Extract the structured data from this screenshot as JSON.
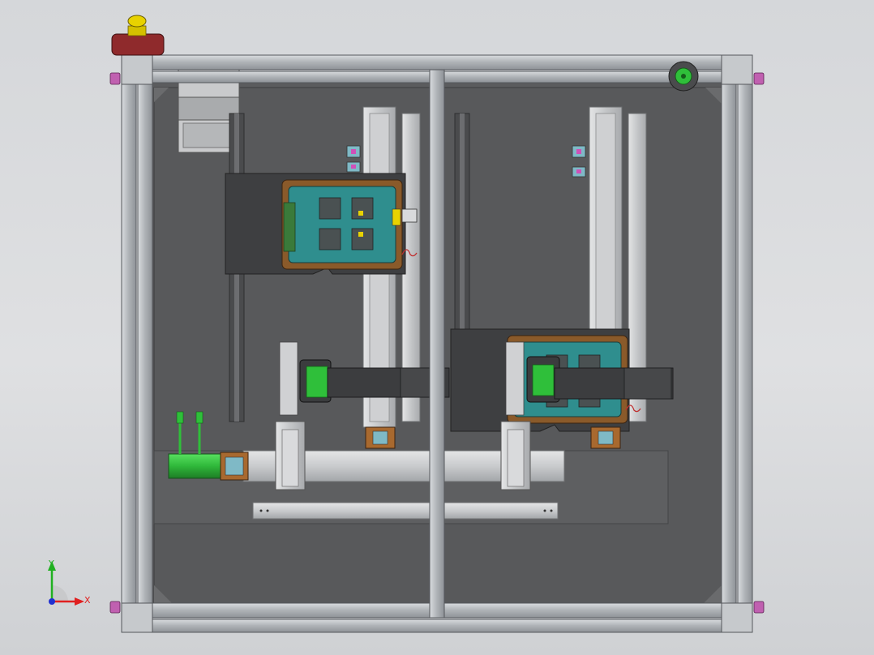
{
  "viewport": {
    "background_top": "#d5d7da",
    "background_bottom": "#cfd1d4"
  },
  "colors": {
    "frame_aluminium": "#b4b8bd",
    "base_plate": "#5a5b5d",
    "rail_silver": "#c7c8c9",
    "fixture_teal": "#2f8e8e",
    "fixture_copper": "#8a5a2a",
    "motor_green": "#2fbf3a",
    "estop_yellow": "#e8d200",
    "estop_red": "#8f2a2c",
    "foot_magenta": "#c060b0"
  },
  "triad": {
    "x_label": "X",
    "y_label": "Y",
    "x_color": "#e02020",
    "y_color": "#20b020",
    "z_color": "#2030d0"
  },
  "components": {
    "estop": "emergency-stop-button",
    "motor": "servo-motor",
    "fixtures": [
      "fixture-left",
      "fixture-right"
    ]
  }
}
